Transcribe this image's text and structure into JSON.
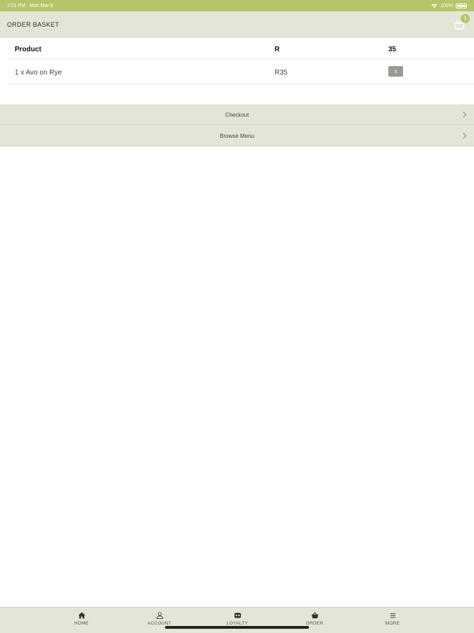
{
  "status_bar": {
    "time": "2:21 PM",
    "date": "Mon Mar 8",
    "battery": "100%"
  },
  "header": {
    "title": "ORDER BASKET",
    "cart_count": "1"
  },
  "table": {
    "columns": [
      "Product",
      "R",
      "35"
    ],
    "rows": [
      {
        "product": "1 x Avo on Rye",
        "price": "R35",
        "remove_label": "x"
      }
    ]
  },
  "actions": [
    {
      "label": "Checkout",
      "icon": "chevron-right-icon"
    },
    {
      "label": "Browse Menu",
      "icon": "chevron-right-icon"
    }
  ],
  "tabs": [
    {
      "label": "HOME",
      "icon": "home-icon"
    },
    {
      "label": "ACCOUNT",
      "icon": "person-icon"
    },
    {
      "label": "LOYALTY",
      "icon": "loyalty-icon"
    },
    {
      "label": "ORDER",
      "icon": "basket-icon"
    },
    {
      "label": "MORE",
      "icon": "menu-icon"
    }
  ],
  "colors": {
    "accent": "#b8c46a",
    "bar_background": "#e4e5d6",
    "remove_button": "#9a9a94"
  }
}
